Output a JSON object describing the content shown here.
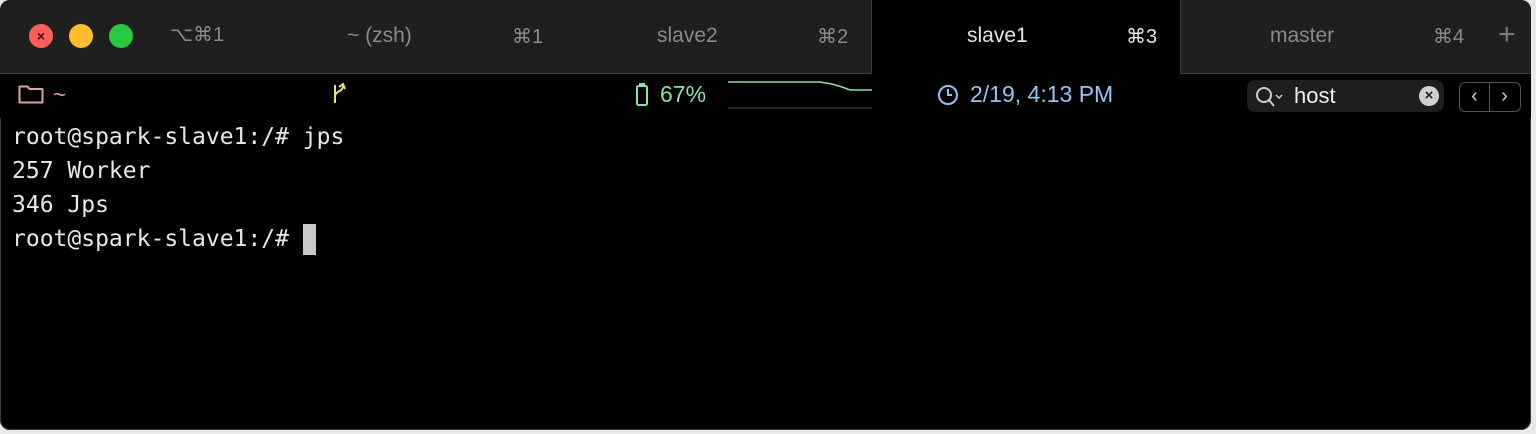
{
  "window": {
    "shortcut": "⌥⌘1"
  },
  "tabs": [
    {
      "label": "~ (zsh)",
      "shortcut": "⌘1",
      "active": false
    },
    {
      "label": "slave2",
      "shortcut": "⌘2",
      "active": false
    },
    {
      "label": "slave1",
      "shortcut": "⌘3",
      "active": true
    },
    {
      "label": "master",
      "shortcut": "⌘4",
      "active": false
    }
  ],
  "new_tab_label": "+",
  "status": {
    "cwd": "~",
    "battery": "67%",
    "datetime": "2/19, 4:13 PM"
  },
  "search": {
    "value": "host"
  },
  "nav": {
    "prev": "‹",
    "next": "›"
  },
  "terminal": {
    "lines": [
      "root@spark-slave1:/# jps",
      "257 Worker",
      "346 Jps",
      "root@spark-slave1:/# "
    ]
  },
  "colors": {
    "background": "#000000",
    "tabbar": "#1f1f1f",
    "cwd": "#e8a0a0",
    "battery": "#8fe0a4",
    "datetime": "#9cc2f0",
    "git": "#e8e080"
  }
}
